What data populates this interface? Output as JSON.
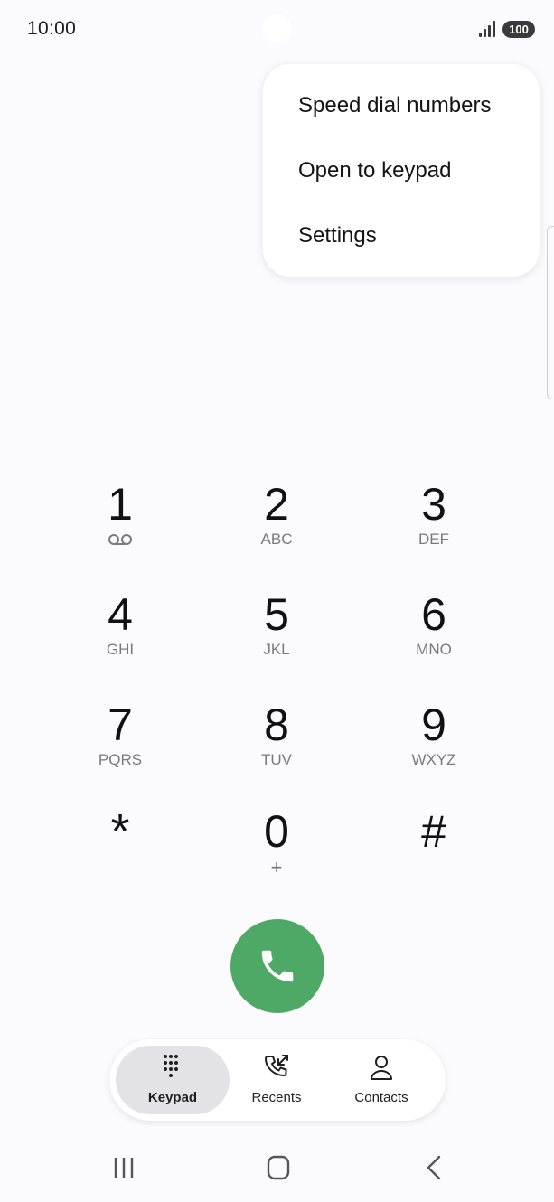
{
  "status_bar": {
    "time": "10:00",
    "battery": "100",
    "signal_icon": "signal-bars-icon"
  },
  "overflow_menu": {
    "items": [
      "Speed dial numbers",
      "Open to keypad",
      "Settings"
    ]
  },
  "keypad": {
    "keys": [
      {
        "digit": "1",
        "sub": "",
        "sub_icon": "voicemail-icon"
      },
      {
        "digit": "2",
        "sub": "ABC"
      },
      {
        "digit": "3",
        "sub": "DEF"
      },
      {
        "digit": "4",
        "sub": "GHI"
      },
      {
        "digit": "5",
        "sub": "JKL"
      },
      {
        "digit": "6",
        "sub": "MNO"
      },
      {
        "digit": "7",
        "sub": "PQRS"
      },
      {
        "digit": "8",
        "sub": "TUV"
      },
      {
        "digit": "9",
        "sub": "WXYZ"
      },
      {
        "digit": "*",
        "sub": ""
      },
      {
        "digit": "0",
        "sub": "+"
      },
      {
        "digit": "#",
        "sub": ""
      }
    ]
  },
  "call_button": {
    "icon": "phone-icon",
    "color": "#4ea866"
  },
  "tabs": [
    {
      "label": "Keypad",
      "icon": "dialpad-icon",
      "active": true
    },
    {
      "label": "Recents",
      "icon": "recents-call-icon",
      "active": false
    },
    {
      "label": "Contacts",
      "icon": "person-icon",
      "active": false
    }
  ],
  "system_nav": {
    "recent_apps_icon": "recent-apps-icon",
    "home_icon": "home-icon",
    "back_icon": "back-icon"
  }
}
